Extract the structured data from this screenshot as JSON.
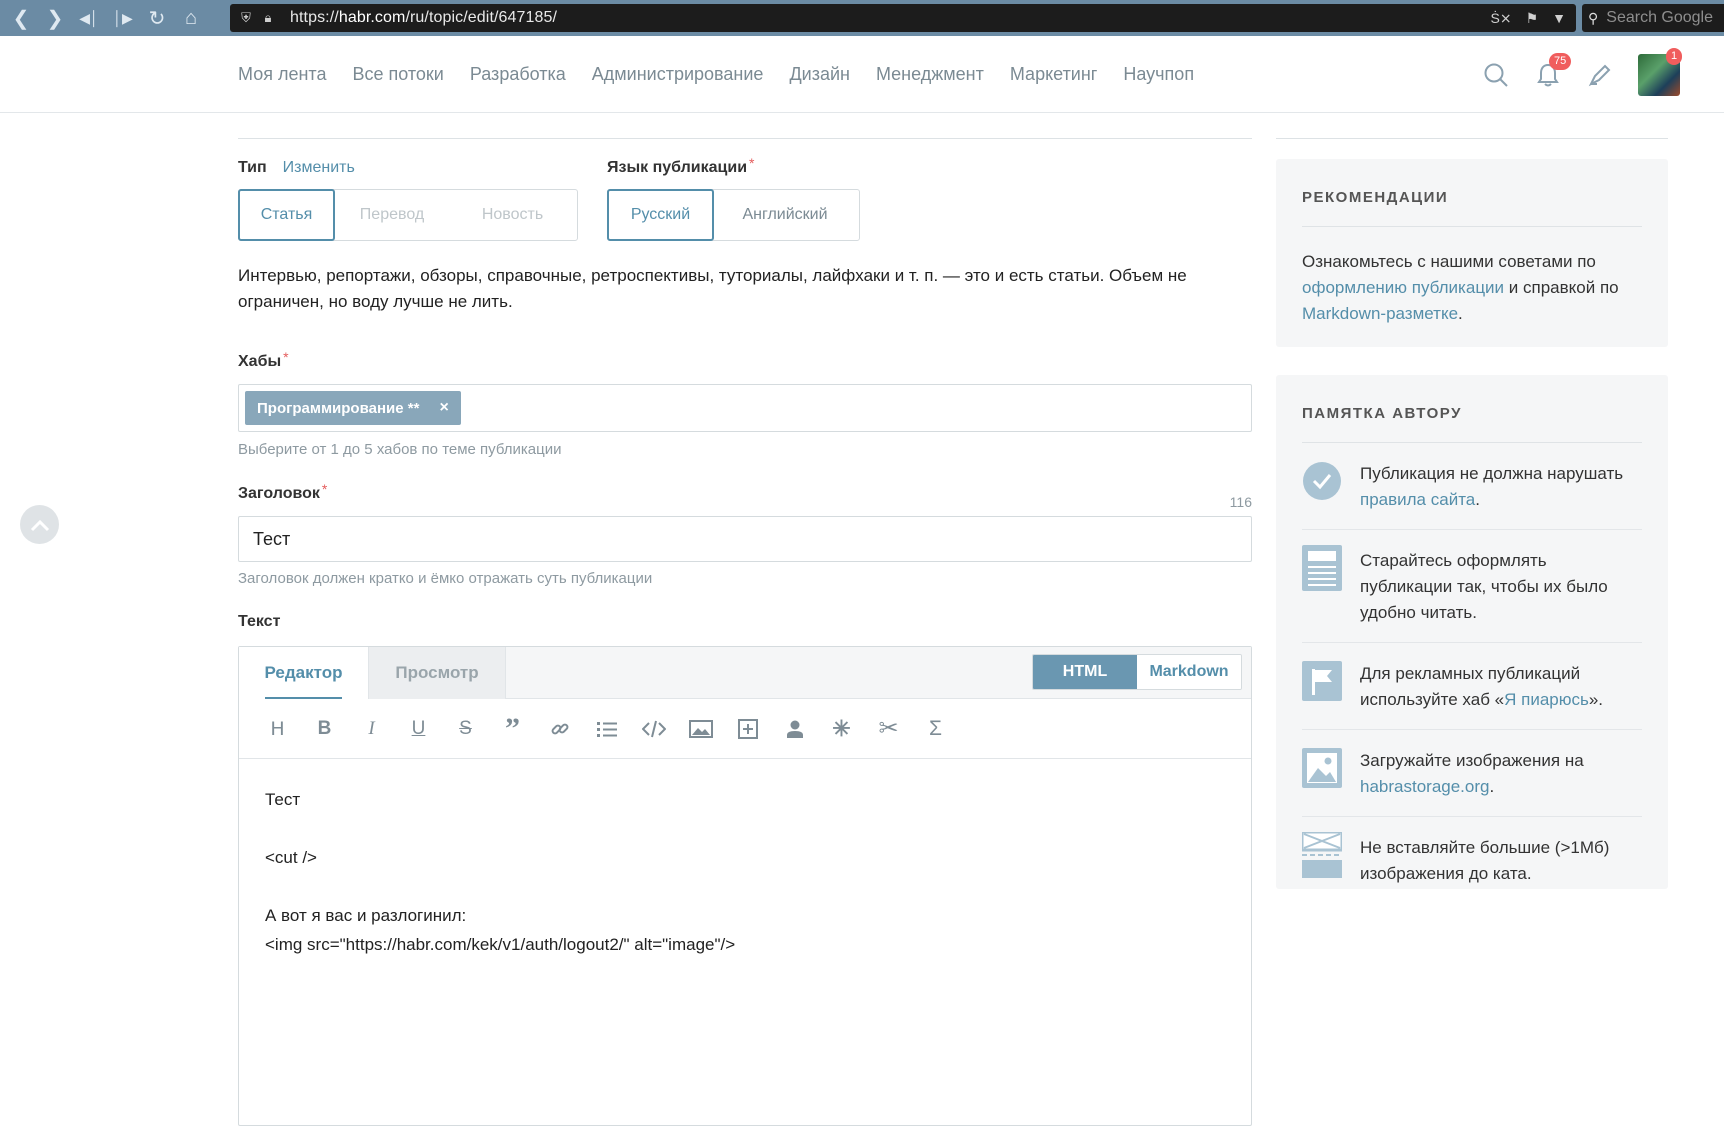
{
  "browser": {
    "url_prefix": "https://",
    "url_host": "habr.com",
    "url_path": "/ru/topic/edit/647185/",
    "search_placeholder": "Search Google"
  },
  "nav": {
    "items": [
      "Моя лента",
      "Все потоки",
      "Разработка",
      "Администрирование",
      "Дизайн",
      "Менеджмент",
      "Маркетинг",
      "Научпоп"
    ]
  },
  "header": {
    "notifications_count": "75",
    "avatar_badge": "1"
  },
  "form": {
    "type_label": "Тип",
    "type_change_link": "Изменить",
    "type_options": [
      "Статья",
      "Перевод",
      "Новость"
    ],
    "language_label": "Язык публикации",
    "language_options": [
      "Русский",
      "Английский"
    ],
    "type_description": "Интервью, репортажи, обзоры, справочные, ретроспективы, туториалы, лайфхаки и т. п. — это и есть статьи. Объем не ограничен, но воду лучше не лить.",
    "hubs_label": "Хабы",
    "hub_tag": "Программирование **",
    "hub_tag_remove": "×",
    "hubs_hint": "Выберите от 1 до 5 хабов по теме публикации",
    "title_label": "Заголовок",
    "title_counter": "116",
    "title_value": "Тест",
    "title_hint": "Заголовок должен кратко и ёмко отражать суть публикации",
    "text_label": "Текст",
    "required_mark": "*"
  },
  "editor": {
    "tab_editor": "Редактор",
    "tab_preview": "Просмотр",
    "mode_html": "HTML",
    "mode_markdown": "Markdown",
    "toolbar_icons": [
      "heading-icon",
      "bold-icon",
      "italic-icon",
      "underline-icon",
      "strikethrough-icon",
      "quote-icon",
      "link-icon",
      "list-icon",
      "code-icon",
      "image-icon",
      "embed-icon",
      "user-icon",
      "anchor-icon",
      "cut-icon",
      "formula-icon"
    ],
    "content_lines": [
      "Тест",
      "",
      "<cut />",
      "",
      "А вот я вас и разлогинил:",
      "<img src=\"https://habr.com/kek/v1/auth/logout2/\" alt=\"image\"/>"
    ]
  },
  "sidebar": {
    "recommendations": {
      "title": "РЕКОМЕНДАЦИИ",
      "text_1": "Ознакомьтесь с нашими советами по",
      "link_1": "оформлению публикации",
      "text_2": "и справкой по",
      "link_2": "Markdown-разметке",
      "text_3": "."
    },
    "author_memo": {
      "title": "ПАМЯТКА АВТОРУ",
      "tips": [
        {
          "icon": "check-circle-icon",
          "text": "Публикация не должна нарушать",
          "link": "правила сайта",
          "after": "."
        },
        {
          "icon": "document-icon",
          "text": "Старайтесь оформлять публикации так, чтобы их было удобно читать.",
          "link": "",
          "after": ""
        },
        {
          "icon": "flag-icon",
          "text": "Для рекламных публикаций используйте хаб «",
          "link": "Я пиарюсь",
          "after": "»."
        },
        {
          "icon": "picture-icon",
          "text": "Загружайте изображения на",
          "link": "habrastorage.org",
          "after": "."
        },
        {
          "icon": "cut-line-icon",
          "text": "Не вставляйте большие (>1Мб) изображения до ката.",
          "link": "",
          "after": ""
        }
      ]
    }
  },
  "colors": {
    "accent": "#548eaa",
    "browser_bar": "#6b8ba4",
    "badge": "#f05d5d",
    "hub_tag": "#89a7ba",
    "icon_blue": "#a9c3d3"
  }
}
